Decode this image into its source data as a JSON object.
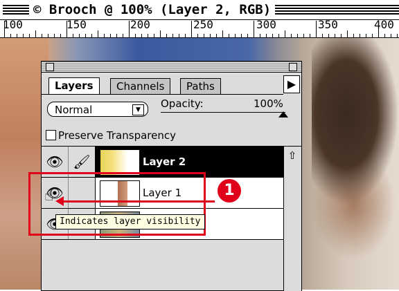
{
  "window": {
    "title": "© Brooch @ 100% (Layer 2, RGB)"
  },
  "ruler": {
    "labels": [
      "100",
      "150",
      "200",
      "250",
      "300",
      "350",
      "400"
    ]
  },
  "palette": {
    "tabs": [
      {
        "label": "Layers",
        "active": true
      },
      {
        "label": "Channels",
        "active": false
      },
      {
        "label": "Paths",
        "active": false
      }
    ],
    "blend_mode": "Normal",
    "opacity_label": "Opacity:",
    "opacity_value": "100%",
    "opacity_fraction": 1.0,
    "preserve_transparency": {
      "label": "Preserve Transparency",
      "checked": false
    },
    "layers": [
      {
        "name": "Layer 2",
        "visible": true,
        "editable": true,
        "selected": true
      },
      {
        "name": "Layer 1",
        "visible": true,
        "editable": false,
        "selected": false
      },
      {
        "name": "",
        "visible": true,
        "editable": false,
        "selected": false
      }
    ]
  },
  "annotation": {
    "tooltip": "Indicates layer visibility",
    "step_number": "1",
    "accent_color": "#e0001a"
  },
  "icons": [
    "eye-icon",
    "brush-icon",
    "scroll-up-arrow-icon",
    "palette-menu-arrow-icon",
    "pointing-hand-cursor-icon"
  ]
}
